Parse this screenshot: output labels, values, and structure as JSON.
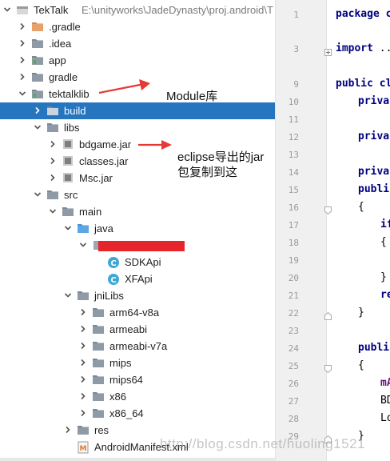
{
  "colors": {
    "selection": "#2675bf",
    "folder": "#8e9aa6",
    "folder_orange": "#e8a16a",
    "arrow": "#e53935",
    "redaction": "#e5252a",
    "class_icon": "#3fa7d6"
  },
  "tree": [
    {
      "label": "TekTalk",
      "secondary": "E:\\unityworks\\JadeDynasty\\proj.android\\T",
      "icon": "module-icon",
      "indent": 0,
      "arrow": "down"
    },
    {
      "label": ".gradle",
      "icon": "folder-orange-icon",
      "indent": 1,
      "arrow": "right"
    },
    {
      "label": ".idea",
      "icon": "folder-icon",
      "indent": 1,
      "arrow": "right"
    },
    {
      "label": "app",
      "icon": "module-folder-icon",
      "indent": 1,
      "arrow": "right"
    },
    {
      "label": "gradle",
      "icon": "folder-icon",
      "indent": 1,
      "arrow": "right"
    },
    {
      "label": "tektalklib",
      "icon": "module-folder-icon",
      "indent": 1,
      "arrow": "down"
    },
    {
      "label": "build",
      "icon": "folder-icon",
      "indent": 2,
      "arrow": "right",
      "selected": true
    },
    {
      "label": "libs",
      "icon": "folder-icon",
      "indent": 2,
      "arrow": "down"
    },
    {
      "label": "bdgame.jar",
      "icon": "jar-icon",
      "indent": 3,
      "arrow": "right"
    },
    {
      "label": "classes.jar",
      "icon": "jar-icon",
      "indent": 3,
      "arrow": "right"
    },
    {
      "label": "Msc.jar",
      "icon": "jar-icon",
      "indent": 3,
      "arrow": "right"
    },
    {
      "label": "src",
      "icon": "folder-icon",
      "indent": 2,
      "arrow": "down"
    },
    {
      "label": "main",
      "icon": "folder-icon",
      "indent": 3,
      "arrow": "down"
    },
    {
      "label": "java",
      "icon": "folder-blue-icon",
      "indent": 4,
      "arrow": "down"
    },
    {
      "label": "",
      "icon": "package-icon",
      "indent": 5,
      "arrow": "down",
      "redacted": true
    },
    {
      "label": "SDKApi",
      "icon": "class-icon",
      "indent": 6,
      "arrow": "none"
    },
    {
      "label": "XFApi",
      "icon": "class-icon",
      "indent": 6,
      "arrow": "none"
    },
    {
      "label": "jniLibs",
      "icon": "folder-icon",
      "indent": 4,
      "arrow": "down"
    },
    {
      "label": "arm64-v8a",
      "icon": "folder-icon",
      "indent": 5,
      "arrow": "right"
    },
    {
      "label": "armeabi",
      "icon": "folder-icon",
      "indent": 5,
      "arrow": "right"
    },
    {
      "label": "armeabi-v7a",
      "icon": "folder-icon",
      "indent": 5,
      "arrow": "right"
    },
    {
      "label": "mips",
      "icon": "folder-icon",
      "indent": 5,
      "arrow": "right"
    },
    {
      "label": "mips64",
      "icon": "folder-icon",
      "indent": 5,
      "arrow": "right"
    },
    {
      "label": "x86",
      "icon": "folder-icon",
      "indent": 5,
      "arrow": "right"
    },
    {
      "label": "x86_64",
      "icon": "folder-icon",
      "indent": 5,
      "arrow": "right"
    },
    {
      "label": "res",
      "icon": "folder-icon",
      "indent": 4,
      "arrow": "right"
    },
    {
      "label": "AndroidManifest.xml",
      "icon": "manifest-icon",
      "indent": 4,
      "arrow": "none"
    }
  ],
  "annotations": {
    "module_note": "Module库",
    "jar_note_line1": "eclipse导出的jar",
    "jar_note_line2": "包复制到这"
  },
  "editor": {
    "line_numbers": [
      "1",
      "3",
      "9",
      "10",
      "11",
      "12",
      "13",
      "14",
      "15",
      "16",
      "17",
      "18",
      "19",
      "20",
      "21",
      "22",
      "23",
      "24",
      "25",
      "26",
      "27",
      "28",
      "29"
    ],
    "code": {
      "l1": "package c",
      "l3_kw": "import",
      "l3_rest": " ..",
      "l9_kw": "public",
      "l9_rest": " cl",
      "priv1": "priva",
      "priv2": "priva",
      "priv3": "priva",
      "publi1": "publi",
      "brace_open1": "{",
      "if_kw": "if",
      "brace_open2": "{",
      "brace_close2": "}",
      "re_kw": "re",
      "brace_close1": "}",
      "publi2": "publi",
      "brace_open3": "{",
      "ma_field": "mA",
      "bd_text": "BD",
      "lo_text": "Lo",
      "brace_close3": "}"
    }
  },
  "watermark": "http://blog.csdn.net/huoling1521"
}
